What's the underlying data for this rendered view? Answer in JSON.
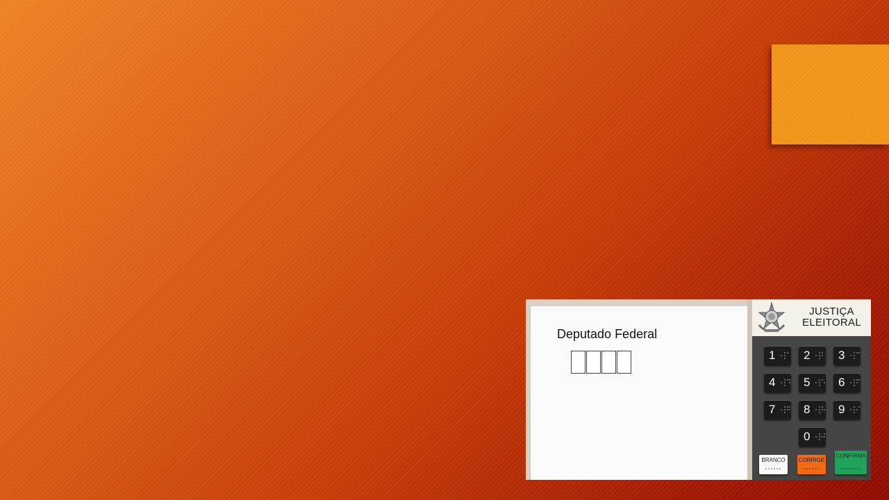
{
  "colors": {
    "accent_block": "#f0951a",
    "branco_key": "#fbfbfb",
    "corrige_key": "#f26a11",
    "confirma_key": "#1fa35a",
    "keypad_bg": "#454545"
  },
  "urna": {
    "screen": {
      "office_label": "Deputado Federal",
      "digits": [
        "",
        "",
        "",
        ""
      ]
    },
    "header": {
      "emblem": "brazil-coat-of-arms-icon",
      "title_line1": "JUSTIÇA",
      "title_line2": "ELEITORAL"
    },
    "keypad": {
      "keys": [
        "1",
        "2",
        "3",
        "4",
        "5",
        "6",
        "7",
        "8",
        "9",
        "0"
      ],
      "branco_label": "BRANCO",
      "corrige_label": "CORRIGE",
      "confirma_label": "CONFIRMA"
    }
  }
}
